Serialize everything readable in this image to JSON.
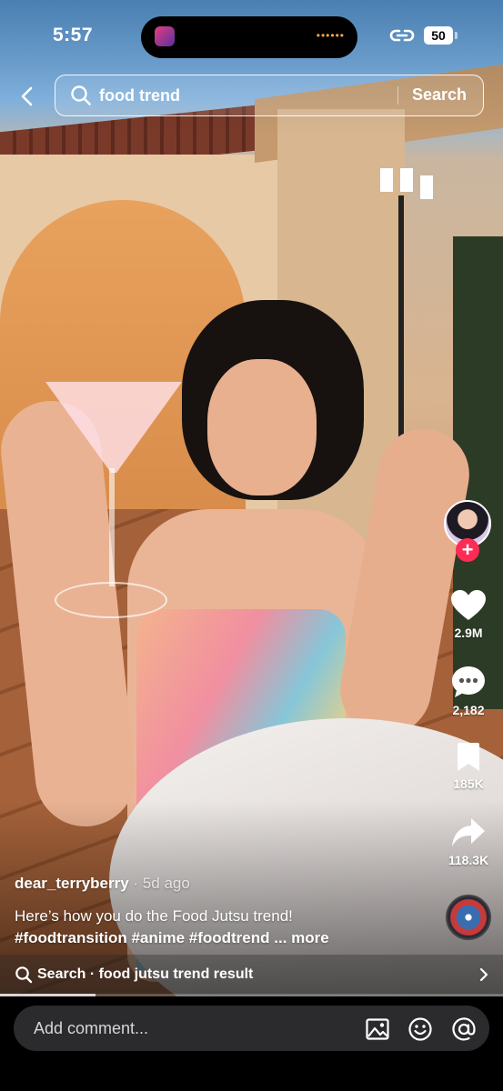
{
  "status_bar": {
    "time": "5:57",
    "battery": "50"
  },
  "search": {
    "query": "food trend",
    "button_label": "Search"
  },
  "actions": {
    "likes": "2.9M",
    "comments": "2,182",
    "saves": "185K",
    "shares": "118.3K"
  },
  "creator": {
    "follow_symbol": "+"
  },
  "caption": {
    "username": "dear_terryberry",
    "posted": " · 5d ago",
    "text": "Here’s how you do the Food Jutsu trend!",
    "hashtags": "#foodtransition #anime #foodtrend",
    "more": " ... more"
  },
  "suggestion": {
    "text": "Search · food jutsu trend result"
  },
  "playback": {
    "progress": 0.19
  },
  "comment_bar": {
    "placeholder": "Add comment..."
  },
  "colors": {
    "follow": "#fe2c55",
    "comment_bg": "#2b2b2d"
  }
}
